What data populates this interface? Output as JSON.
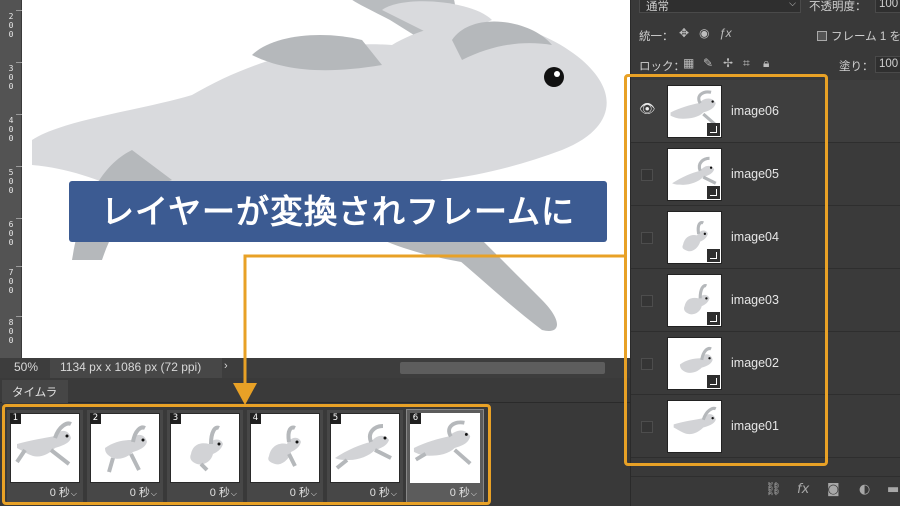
{
  "ruler": {
    "labels": [
      "2\n0\n0",
      "3\n0\n0",
      "4\n0\n0",
      "5\n0\n0",
      "6\n0\n0",
      "7\n0\n0",
      "8\n0\n0"
    ]
  },
  "callout": {
    "text": "レイヤーが変換されフレームに"
  },
  "statusbar": {
    "zoom": "50%",
    "doc_size": "1134 px x 1086 px (72 ppi)",
    "arrow": "›"
  },
  "timeline": {
    "tab": "タイムライン",
    "frames": [
      {
        "number": "1",
        "delay": "0 秒"
      },
      {
        "number": "2",
        "delay": "0 秒"
      },
      {
        "number": "3",
        "delay": "0 秒"
      },
      {
        "number": "4",
        "delay": "0 秒"
      },
      {
        "number": "5",
        "delay": "0 秒"
      },
      {
        "number": "6",
        "delay": "0 秒"
      }
    ],
    "chevron": "⌵"
  },
  "layers_panel": {
    "blend_mode": "通常",
    "opacity_label": "不透明度：",
    "opacity_value": "100",
    "unify_label": "統一：",
    "propagate_label": "フレーム 1 を",
    "lock_label": "ロック：",
    "fill_label": "塗り：",
    "fill_value": "100",
    "layers": [
      {
        "name": "image06",
        "visible": true
      },
      {
        "name": "image05",
        "visible": false
      },
      {
        "name": "image04",
        "visible": false
      },
      {
        "name": "image03",
        "visible": false
      },
      {
        "name": "image02",
        "visible": false
      },
      {
        "name": "image01",
        "visible": false
      }
    ],
    "footer_icons": [
      "link-icon",
      "fx-icon",
      "mask-icon",
      "adjustment-icon",
      "group-icon"
    ],
    "footer_fx": "fx"
  },
  "colors": {
    "accent_outline": "#e8a126",
    "callout_bg": "#3c5b92",
    "rabbit_light": "#d9dadd",
    "rabbit_dark": "#b5b8bb"
  }
}
